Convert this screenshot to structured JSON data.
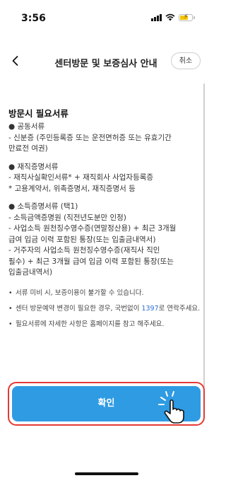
{
  "status_bar": {
    "time": "3:56"
  },
  "nav": {
    "title": "센터방문 및 보증심사 안내",
    "cancel_label": "취소"
  },
  "content": {
    "heading": "방문시 필요서류",
    "groups": [
      {
        "title": "● 공동서류",
        "lines": [
          "- 신분증 (주민등록증 또는 운전면허증 또는 유효기간",
          "만료전 여권)"
        ]
      },
      {
        "title": "● 재직증명서류",
        "lines": [
          "- 재직사실확인서류* + 재직회사 사업자등록증",
          "* 고용계약서, 위촉증명서, 재직증명서 등"
        ]
      },
      {
        "title": "● 소득증명서류 (택1)",
        "lines": [
          "- 소득금액증명원 (직전년도분만 인정)",
          "- 사업소득 원천징수영수증(연말정산용) + 최근 3개월",
          "급여 입금 이력 포함된 통장(또는 입출금내역서)",
          "- 거주자의 사업소득 원천징수영수증(재직사 직인",
          "필수) + 최근 3개월 급여 입금 이력 포함된 통장(또는",
          "입출금내역서)"
        ]
      }
    ],
    "notes": [
      {
        "bullet": "•",
        "text": "서류 미비 시, 보증이용이 불가할 수 있습니다."
      },
      {
        "bullet": "•",
        "text_before": "센터 방문예약 변경이 필요한 경우, 국번없이 ",
        "phone": "1397",
        "text_after": "로 연락주세요."
      },
      {
        "bullet": "•",
        "text": "필요서류에 자세한 사항은 홈페이지를 참고 해주세요."
      }
    ]
  },
  "confirm_label": "확인",
  "colors": {
    "accent": "#2f9be3",
    "highlight": "#e53935",
    "link": "#2e6fd9"
  },
  "icons": [
    "back-chevron-icon",
    "signal-icon",
    "wifi-icon",
    "battery-charging-icon",
    "tap-hand-icon"
  ]
}
